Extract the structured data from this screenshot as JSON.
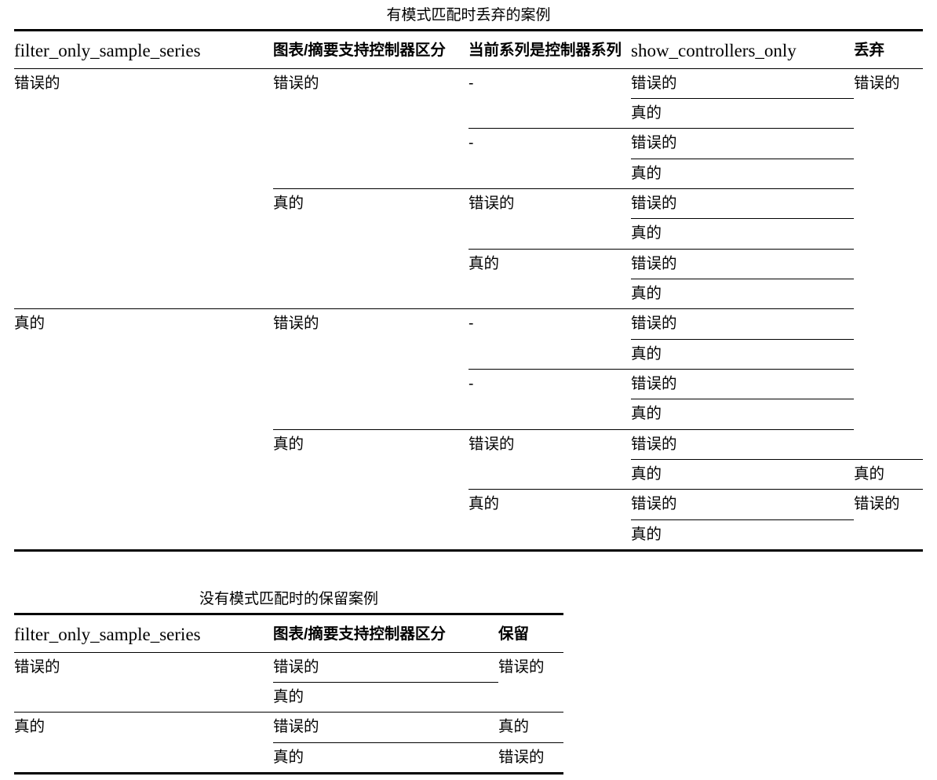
{
  "page": {
    "background": "#ffffff",
    "text_color": "#000000"
  },
  "table1": {
    "caption": "有模式匹配时丢弃的案例",
    "columns": [
      {
        "key": "filter_only_sample_series",
        "label": "filter_only_sample_series",
        "style": "serif"
      },
      {
        "key": "chart_summary_supports_controller_distinction",
        "label": "图表/摘要支持控制器区分",
        "style": "sans-bold"
      },
      {
        "key": "current_series_is_controller_series",
        "label": "当前系列是控制器系列",
        "style": "sans-bold"
      },
      {
        "key": "show_controllers_only",
        "label": "show_controllers_only",
        "style": "serif"
      },
      {
        "key": "discard",
        "label": "丢弃",
        "style": "sans-bold"
      }
    ],
    "rows": [
      {
        "c1": "错误的",
        "c2": "错误的",
        "c3": "-",
        "c4": "错误的",
        "c5": "错误的"
      },
      {
        "c1": "",
        "c2": "",
        "c3": "",
        "c4": "真的",
        "c5": ""
      },
      {
        "c1": "",
        "c2": "",
        "c3": "-",
        "c4": "错误的",
        "c5": ""
      },
      {
        "c1": "",
        "c2": "",
        "c3": "",
        "c4": "真的",
        "c5": ""
      },
      {
        "c1": "",
        "c2": "真的",
        "c3": "错误的",
        "c4": "错误的",
        "c5": ""
      },
      {
        "c1": "",
        "c2": "",
        "c3": "",
        "c4": "真的",
        "c5": ""
      },
      {
        "c1": "",
        "c2": "",
        "c3": "真的",
        "c4": "错误的",
        "c5": ""
      },
      {
        "c1": "",
        "c2": "",
        "c3": "",
        "c4": "真的",
        "c5": ""
      },
      {
        "c1": "真的",
        "c2": "错误的",
        "c3": "-",
        "c4": "错误的",
        "c5": ""
      },
      {
        "c1": "",
        "c2": "",
        "c3": "",
        "c4": "真的",
        "c5": ""
      },
      {
        "c1": "",
        "c2": "",
        "c3": "-",
        "c4": "错误的",
        "c5": ""
      },
      {
        "c1": "",
        "c2": "",
        "c3": "",
        "c4": "真的",
        "c5": ""
      },
      {
        "c1": "",
        "c2": "真的",
        "c3": "错误的",
        "c4": "错误的",
        "c5": ""
      },
      {
        "c1": "",
        "c2": "",
        "c3": "",
        "c4": "真的",
        "c5": "真的"
      },
      {
        "c1": "",
        "c2": "",
        "c3": "真的",
        "c4": "错误的",
        "c5": "错误的"
      },
      {
        "c1": "",
        "c2": "",
        "c3": "",
        "c4": "真的",
        "c5": ""
      }
    ]
  },
  "table2": {
    "caption": "没有模式匹配时的保留案例",
    "columns": [
      {
        "key": "filter_only_sample_series",
        "label": "filter_only_sample_series",
        "style": "serif"
      },
      {
        "key": "chart_summary_supports_controller_distinction",
        "label": "图表/摘要支持控制器区分",
        "style": "sans-bold"
      },
      {
        "key": "keep",
        "label": "保留",
        "style": "sans-bold"
      }
    ],
    "rows": [
      {
        "c1": "错误的",
        "c2": "错误的",
        "c3": "错误的"
      },
      {
        "c1": "",
        "c2": "真的",
        "c3": ""
      },
      {
        "c1": "真的",
        "c2": "错误的",
        "c3": "真的"
      },
      {
        "c1": "",
        "c2": "真的",
        "c3": "错误的"
      }
    ]
  }
}
